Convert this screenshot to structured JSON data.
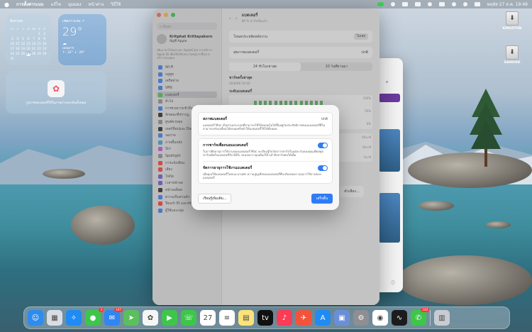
{
  "menubar": {
    "app_name": "การตั้งค่าระบบ",
    "menus": [
      "แก้ไข",
      "มุมมอง",
      "หน้าต่าง",
      "วิธีใช้"
    ],
    "clock": "พฤหัส 27 ส.ค.  19:49"
  },
  "calendar_widget": {
    "month": "สิงหาคม",
    "weekdays": [
      "อา",
      "จ",
      "อ",
      "พ",
      "พฤ",
      "ศ",
      "ส"
    ],
    "days": [
      "",
      "",
      "",
      "",
      "",
      "1",
      "2",
      "3",
      "4",
      "5",
      "6",
      "7",
      "8",
      "9",
      "10",
      "11",
      "12",
      "13",
      "14",
      "15",
      "16",
      "17",
      "18",
      "19",
      "20",
      "21",
      "22",
      "23",
      "24",
      "25",
      "26",
      "27",
      "28",
      "29",
      "30",
      "31"
    ],
    "today": "27"
  },
  "weather_widget": {
    "city": "เชตภาวเจน ↗",
    "temperature": "29°",
    "condition": "เมฆมาก",
    "range": "↑: 32° ↓: 26°"
  },
  "photos_widget": {
    "caption": "รูปภาพของคุณที่ใช้ในภาพถ่ายของฉันทั้งหมด"
  },
  "desktop": {
    "drives": [
      "KINGSTON",
      "SANDISK"
    ]
  },
  "settings_window": {
    "search_placeholder": "ค้นหา",
    "user_name": "Kritphat Krittayakorn",
    "user_sub": "บัญชี Apple",
    "sidebar_note": "เพิ่มภาพ iCloud และ AppleCare จากบริการ Apple ID เพื่อให้ได้รับประโยชน์มากขึ้นจากบริการของคุณ",
    "sidebar_items": [
      "Wi-Fi",
      "บลูทูธ",
      "เครือข่าย",
      "VPN",
      "แบตเตอรี่",
      "ทั่วไป",
      "การช่วยการเข้าถึง",
      "ลักษณะที่ปรากฏ",
      "ศูนย์ควบคุม",
      "เดสก์ท็อปและ Dock",
      "จอภาพ",
      "ภาพพื้นหลัง",
      "Siri",
      "Spotlight",
      "การแจ้งเตือน",
      "เสียง",
      "โฟกัส",
      "เวลาหน้าจอ",
      "หน้าจอล็อค",
      "ความเป็นส่วนตัว",
      "Touch ID และรหัสผ่าน",
      "ผู้ใช้และกลุ่ม"
    ],
    "active_item": "แบตเตอรี่",
    "header_title": "แบตเตอรี่",
    "header_sub": "88 % ชาร์จเต็มแล้ว",
    "row1_label": "โหมดประหยัดพลังงาน",
    "row1_value": "ไม่เลย",
    "row2_label": "สุขภาพแบตเตอรี่",
    "row2_value": "ปกติ",
    "tabs": [
      "24 ชั่วโมงล่าสุด",
      "10 วันที่ผ่านมา"
    ],
    "charge_label": "ชาร์จครั้งล่าสุด",
    "charge_time": "26/8/68 19:40",
    "level_label": "ระดับแบตเตอรี่",
    "axis_levels": [
      "100%",
      "50%",
      "0%"
    ],
    "usage_axis": [
      "60นาที",
      "30นาที",
      "0นาที"
    ],
    "options_button": "ตัวเลือก..."
  },
  "dialog": {
    "health_title": "สภาพแบตเตอรี่",
    "health_value": "ปกติ",
    "health_text": "แบตเตอรี่ Mac เป็นส่วนประกอบที่สามารถใช้ได้ตลอดไม่ได้ขึ้นอยู่กับประสิทธิภาพของแบตเตอรี่ที่ไม่สามารถปรับเปลี่ยนได้ตลอดหรือทำให้แบตเตอรี่ใช้ได้ทั้งหมด",
    "optimize_title": "การชาร์จเพื่อถนอมแบตเตอรี่",
    "optimize_text": "ในการยืดอายุการใช้งานของแบตเตอรี่ Mac จะเรียนรู้กิจวัตรการชาร์จในแต่ละวันของคุณเพื่อหยุดชาร์จเมื่อถึงแบตเตอรี่ถึง 80% ก่อนจนกว่าคุณต้องใช้ แล้วจึงชาร์จต่อให้เต็ม",
    "manage_title": "จัดการอายุการใช้งานแบตเตอรี่",
    "manage_text": "เมื่อคุณใช้แบตเตอรี่ในขณะนานพัก ความสูญเสียของแบตเตอรี่ที่จะต้องลดความจุการใช้งานของแบตเตอรี่",
    "learn_more": "เรียนรู้เพิ่มเติม...",
    "done": "เสร็จสิ้น"
  },
  "dock": {
    "apps": [
      {
        "name": "Finder",
        "color": "#2d8cf0",
        "glyph": "☺",
        "badge": ""
      },
      {
        "name": "Launchpad",
        "color": "#d9dde3",
        "glyph": "▦",
        "badge": ""
      },
      {
        "name": "Safari",
        "color": "#1f8bf3",
        "glyph": "✧",
        "badge": ""
      },
      {
        "name": "Messages",
        "color": "#3ec64a",
        "glyph": "●",
        "badge": "3"
      },
      {
        "name": "Mail",
        "color": "#2f86f4",
        "glyph": "✉",
        "badge": "197"
      },
      {
        "name": "Maps",
        "color": "#5bbf5e",
        "glyph": "➤",
        "badge": ""
      },
      {
        "name": "Photos",
        "color": "#f5f5f5",
        "glyph": "✿",
        "badge": ""
      },
      {
        "name": "FaceTime",
        "color": "#3ec64a",
        "glyph": "▶",
        "badge": ""
      },
      {
        "name": "Phone",
        "color": "#3ec64a",
        "glyph": "☏",
        "badge": ""
      },
      {
        "name": "Calendar",
        "color": "#ffffff",
        "glyph": "27",
        "badge": ""
      },
      {
        "name": "Reminders",
        "color": "#ffffff",
        "glyph": "≡",
        "badge": ""
      },
      {
        "name": "Notes",
        "color": "#fbe27a",
        "glyph": "▤",
        "badge": ""
      },
      {
        "name": "Apple TV",
        "color": "#111111",
        "glyph": "tv",
        "badge": ""
      },
      {
        "name": "Music",
        "color": "#fa3c55",
        "glyph": "♪",
        "badge": ""
      },
      {
        "name": "Rocket",
        "color": "#f4533b",
        "glyph": "✈",
        "badge": ""
      },
      {
        "name": "App Store",
        "color": "#1f8bf3",
        "glyph": "A",
        "badge": ""
      },
      {
        "name": "Preview",
        "color": "#6a8fd8",
        "glyph": "▣",
        "badge": ""
      },
      {
        "name": "System Settings",
        "color": "#8e8e93",
        "glyph": "⚙",
        "badge": ""
      },
      {
        "name": "Chrome",
        "color": "#ffffff",
        "glyph": "◉",
        "badge": ""
      },
      {
        "name": "Activity Monitor",
        "color": "#1c1c1e",
        "glyph": "∿",
        "badge": ""
      },
      {
        "name": "LINE",
        "color": "#3ec64a",
        "glyph": "✆",
        "badge": "240"
      },
      {
        "name": "Trash",
        "color": "#c8ccd2",
        "glyph": "▥",
        "badge": ""
      }
    ]
  }
}
